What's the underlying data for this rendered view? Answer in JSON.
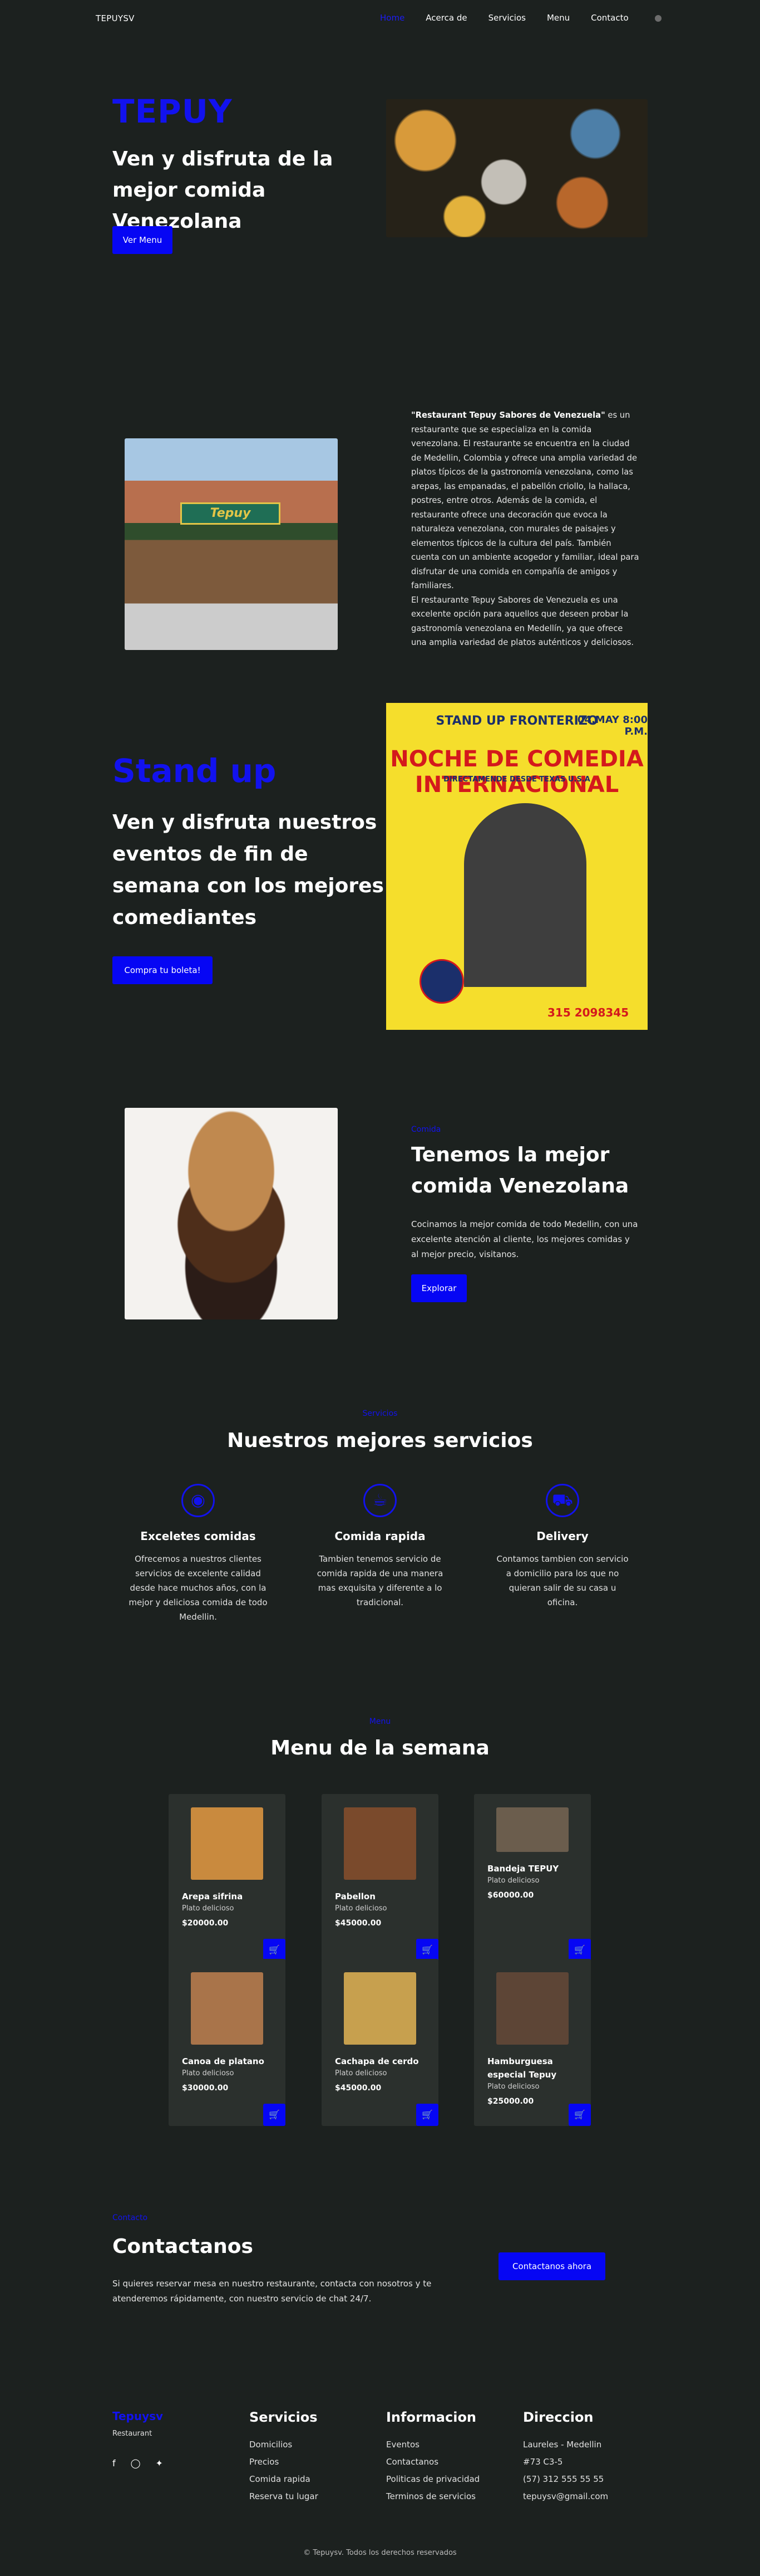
{
  "header": {
    "logo": "TEPUYSV",
    "nav": [
      "Home",
      "Acerca de",
      "Servicios",
      "Menu",
      "Contacto"
    ],
    "active": "Home",
    "theme_icon": "moon-icon"
  },
  "home": {
    "brand": "TEPUY",
    "subtitle": "Ven y disfruta de la mejor comida Venezolana",
    "button": "Ver Menu"
  },
  "about": {
    "bold": "\"Restaurant Tepuy Sabores de Venezuela\"",
    "text": " es un restaurante que se especializa en la comida venezolana. El restaurante se encuentra en la ciudad de Medellin, Colombia y ofrece una amplia variedad de platos típicos de la gastronomía venezolana, como las arepas, las empanadas, el pabellón criollo, la hallaca, postres, entre otros. Además de la comida, el restaurante ofrece una decoración que evoca la naturaleza venezolana, con murales de paisajes y elementos típicos de la cultura del país. También cuenta con un ambiente acogedor y familiar, ideal para disfrutar de una comida en compañía de amigos y familiares.",
    "text2": "El restaurante Tepuy Sabores de Venezuela es una excelente opción para aquellos que deseen probar la gastronomía venezolana en Medellín, ya que ofrece una amplia variedad de platos auténticos y deliciosos.",
    "sign": "Tepuy"
  },
  "standup": {
    "title": "Stand up",
    "subtitle": "Ven y disfruta nuestros eventos de fin de semana con los mejores comediantes",
    "button": "Compra tu boleta!",
    "poster": {
      "line1": "STAND UP FRONTERIZO",
      "line2": "NOCHE DE COMEDIA INTERNACIONAL",
      "line3": "DIRECTAMENDE DESDE TEXAS U.S.A",
      "date": "04.MAY 8:00 P.M.",
      "phone": "315 2098345"
    }
  },
  "food": {
    "label": "Comida",
    "title": "Tenemos la mejor comida Venezolana",
    "text": "Cocinamos la mejor comida de todo Medellin, con una excelente atención al cliente, los mejores comidas y al mejor precio, visitanos.",
    "button": "Explorar"
  },
  "services": {
    "label": "Servicios",
    "title": "Nuestros mejores servicios",
    "items": [
      {
        "title": "Exceletes comidas",
        "text": "Ofrecemos a nuestros clientes servicios de excelente calidad desde hace muchos años, con la mejor y deliciosa comida de todo Medellin.",
        "icon": "food-plate-icon"
      },
      {
        "title": "Comida rapida",
        "text": "Tambien tenemos servicio de comida rapida de una manera mas exquisita y diferente a lo tradicional.",
        "icon": "fast-food-icon"
      },
      {
        "title": "Delivery",
        "text": "Contamos tambien con servicio a domicilio para los que no quieran salir de su casa u oficina.",
        "icon": "delivery-truck-icon"
      }
    ]
  },
  "menu": {
    "label": "Menu",
    "title": "Menu de la semana",
    "items": [
      {
        "name": "Arepa sifrina",
        "desc": "Plato delicioso",
        "price": "$20000.00",
        "color": "#c98a3e"
      },
      {
        "name": "Pabellon",
        "desc": "Plato delicioso",
        "price": "$45000.00",
        "color": "#7a4a2c"
      },
      {
        "name": "Bandeja TEPUY",
        "desc": "Plato delicioso",
        "price": "$60000.00",
        "color": "#6b5d4d"
      },
      {
        "name": "Canoa de platano",
        "desc": "Plato delicioso",
        "price": "$30000.00",
        "color": "#a9744a"
      },
      {
        "name": "Cachapa de cerdo",
        "desc": "Plato delicioso",
        "price": "$45000.00",
        "color": "#c7a04e"
      },
      {
        "name": "Hamburguesa especial Tepuy",
        "desc": "Plato delicioso",
        "price": "$25000.00",
        "color": "#5d4536"
      }
    ],
    "cart_icon": "cart-icon"
  },
  "contact": {
    "label": "Contacto",
    "title": "Contactanos",
    "text": "Si quieres reservar mesa en nuestro restaurante, contacta con nosotros y te atenderemos rápidamente, con nuestro servicio de chat 24/7.",
    "button": "Contactanos ahora"
  },
  "footer": {
    "brand": "Tepuysv",
    "sub": "Restaurant",
    "socials": [
      "facebook-icon",
      "instagram-icon",
      "twitter-icon"
    ],
    "services_title": "Servicios",
    "services": [
      "Domicilios",
      "Precios",
      "Comida rapida",
      "Reserva tu lugar"
    ],
    "info_title": "Informacion",
    "info": [
      "Eventos",
      "Contactanos",
      "Politicas de privacidad",
      "Terminos de servicios"
    ],
    "address_title": "Direccion",
    "address": [
      "Laureles - Medellin",
      "#73 C3-5",
      "(57) 312 555 55 55",
      "tepuysv@gmail.com"
    ],
    "copyright": "© Tepuysv. Todos los derechos reservados"
  },
  "colors": {
    "accent": "#0606f4",
    "background": "#1c211f",
    "card": "#2b302d"
  }
}
